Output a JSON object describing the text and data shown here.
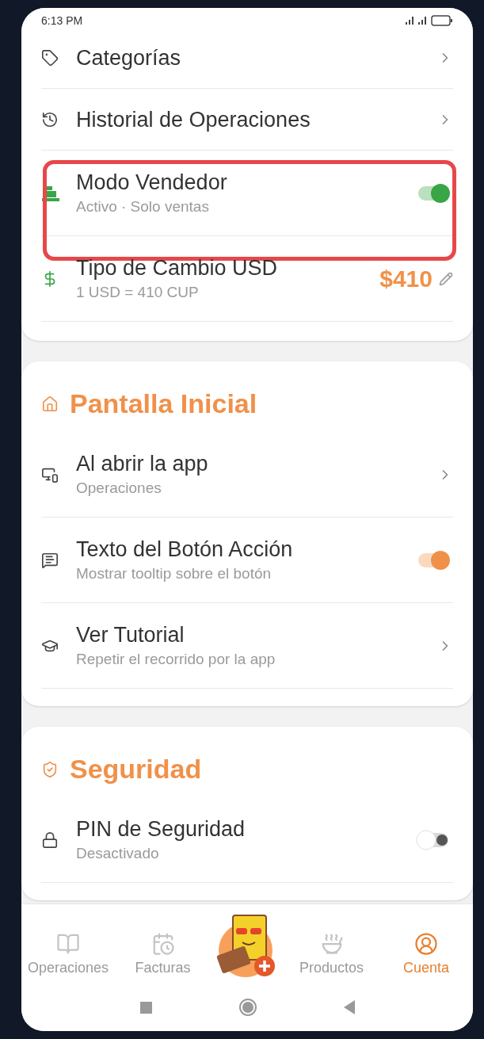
{
  "status_bar": {
    "time": "6:13 PM"
  },
  "top_card": {
    "rows": [
      {
        "kind": "link",
        "title": "Categorías"
      },
      {
        "kind": "link",
        "title": "Historial de Operaciones"
      },
      {
        "kind": "toggle",
        "title": "Modo Vendedor",
        "subtitle": "Activo · Solo ventas",
        "on": true,
        "color": "#3aa546",
        "highlighted": true
      },
      {
        "kind": "value",
        "title": "Tipo de Cambio USD",
        "subtitle": "1 USD = 410 CUP",
        "value": "$410"
      }
    ]
  },
  "sections": [
    {
      "title": "Pantalla Inicial",
      "rows": [
        {
          "kind": "link",
          "title": "Al abrir la app",
          "subtitle": "Operaciones"
        },
        {
          "kind": "toggle",
          "title": "Texto del Botón Acción",
          "subtitle": "Mostrar tooltip sobre el botón",
          "on": true,
          "color": "#f0914a"
        },
        {
          "kind": "link",
          "title": "Ver Tutorial",
          "subtitle": "Repetir el recorrido por la app"
        }
      ]
    },
    {
      "title": "Seguridad",
      "rows": [
        {
          "kind": "toggle",
          "title": "PIN de Seguridad",
          "subtitle": "Desactivado",
          "on": false,
          "color": "#555555"
        }
      ]
    }
  ],
  "bottom_nav": [
    {
      "label": "Operaciones",
      "selected": false
    },
    {
      "label": "Facturas",
      "selected": false
    },
    {
      "label": "Productos",
      "selected": false
    },
    {
      "label": "Cuenta",
      "selected": true
    }
  ]
}
